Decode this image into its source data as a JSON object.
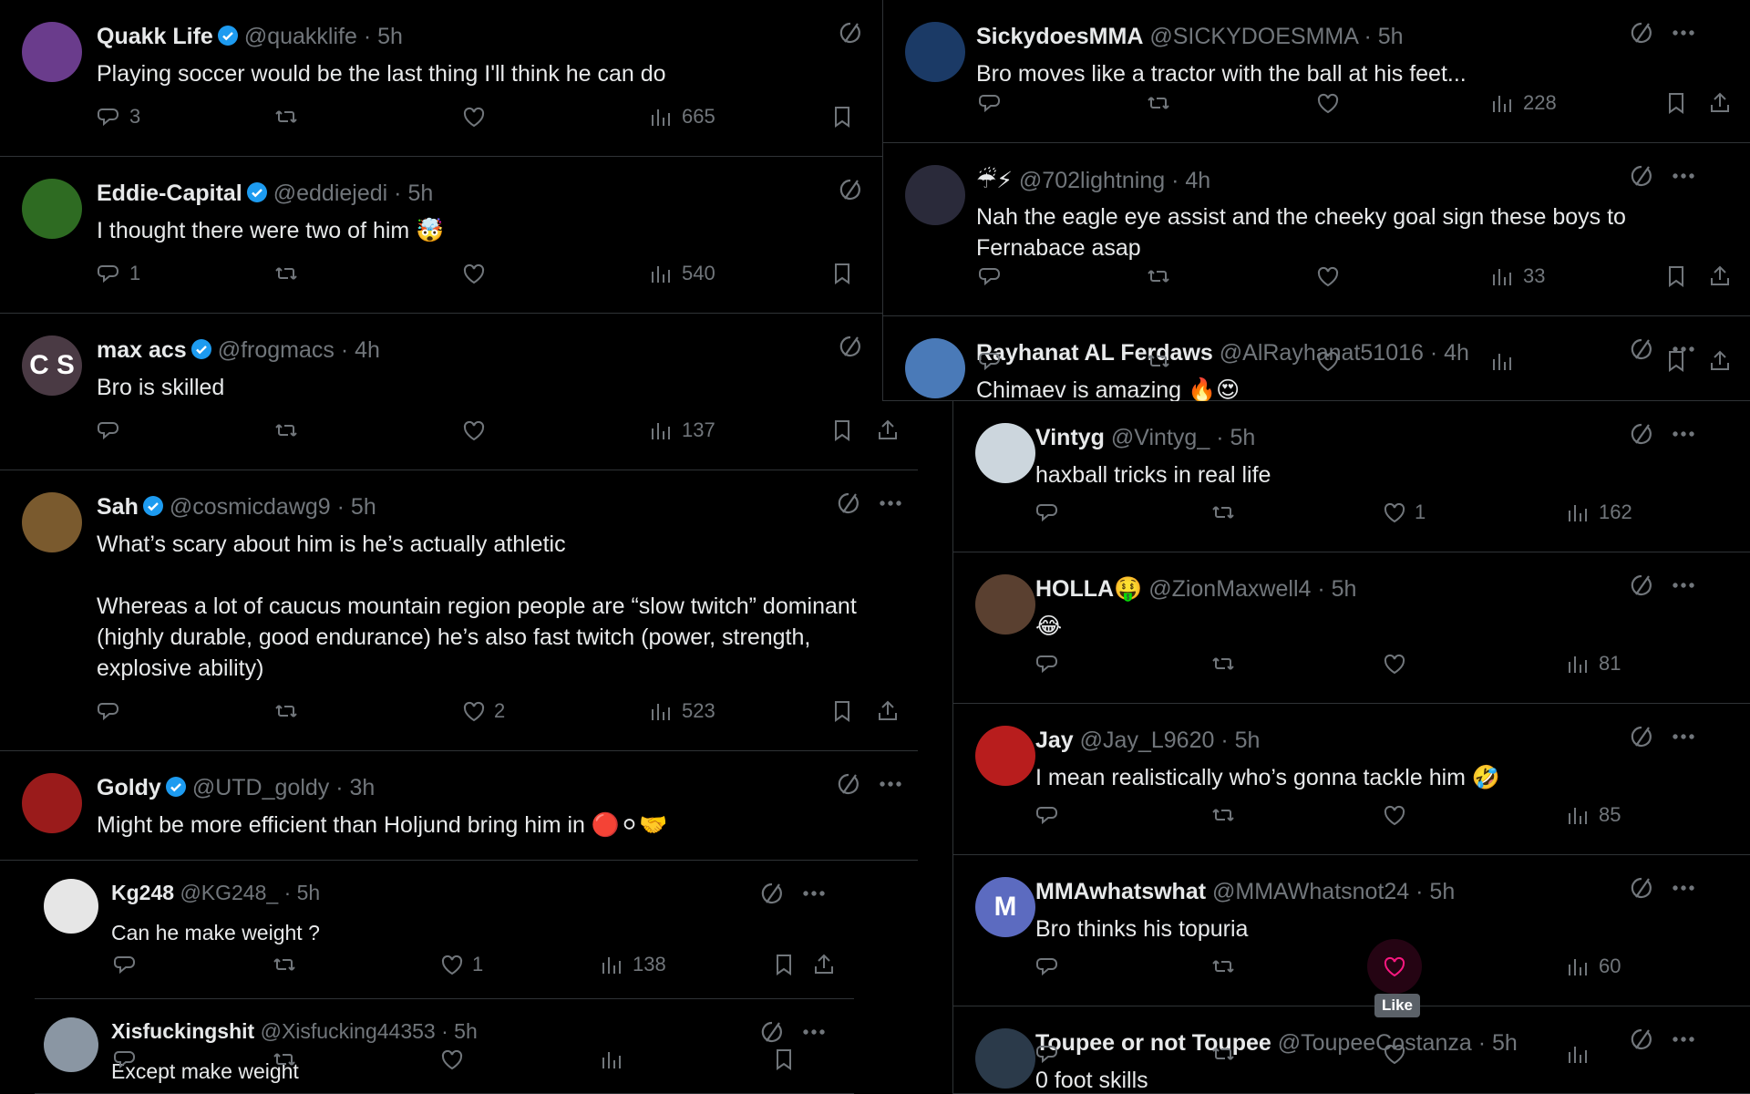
{
  "colors": {
    "background": "#000000",
    "text": "#e7e9ea",
    "muted": "#71767b",
    "verified": "#1d9bf0",
    "like_pink": "#f91880",
    "divider": "#2f3336"
  },
  "left_column": [
    {
      "name": "Quakk Life",
      "verified": true,
      "handle": "@quakklife",
      "time": "· 5h",
      "text": "Playing soccer would be the last thing I'll think he can do",
      "replies": "3",
      "retweets": "",
      "likes": "",
      "views": "665",
      "avatar_color": "#6a3c8c",
      "more_menu": false,
      "share": false
    },
    {
      "name": "Eddie-Capital",
      "verified": true,
      "handle": "@eddiejedi",
      "time": "· 5h",
      "text": "I thought there were two of him 🤯",
      "replies": "1",
      "retweets": "",
      "likes": "",
      "views": "540",
      "avatar_color": "#2e6b22",
      "more_menu": false,
      "share": false
    },
    {
      "name": "max acs",
      "verified": true,
      "handle": "@frogmacs",
      "time": "· 4h",
      "text": "Bro is skilled",
      "replies": "",
      "retweets": "",
      "likes": "",
      "views": "137",
      "avatar_color": "#4a3a44",
      "avatar_text": "C S",
      "more_menu": false,
      "share": true
    },
    {
      "name": "Sah",
      "verified": true,
      "handle": "@cosmicdawg9",
      "time": "· 5h",
      "text": "What’s scary about him is he’s actually athletic\n\nWhereas a lot of caucus mountain region people are “slow twitch” dominant (highly durable, good endurance) he’s also fast twitch (power, strength, explosive ability)",
      "replies": "",
      "retweets": "",
      "likes": "2",
      "views": "523",
      "avatar_color": "#7a5a2e",
      "more_menu": true,
      "share": true
    },
    {
      "name": "Goldy",
      "verified": true,
      "handle": "@UTD_goldy",
      "time": "· 3h",
      "text": "Might be more efficient than Holjund bring him in 🔴⚪🤝",
      "replies": "",
      "retweets": "",
      "likes": "",
      "views": "",
      "avatar_color": "#9a1b1b",
      "more_menu": true,
      "share": false
    },
    {
      "name": "Kg248",
      "verified": false,
      "handle": "@KG248_",
      "time": "· 5h",
      "text": "Can he make weight ?",
      "replies": "",
      "retweets": "",
      "likes": "1",
      "views": "138",
      "avatar_color": "#e6e6e6",
      "more_menu": true,
      "share": true,
      "reply": true
    },
    {
      "name": "Xisfuckingshit",
      "verified": false,
      "handle": "@Xisfucking44353",
      "time": "· 5h",
      "text": "Except make weight",
      "replies": "",
      "retweets": "",
      "likes": "",
      "views": "",
      "avatar_color": "#8a96a3",
      "more_menu": true,
      "share": false,
      "reply": true
    }
  ],
  "right_top_column": [
    {
      "name": "SickydoesMMA",
      "verified": false,
      "handle": "@SICKYDOESMMA",
      "time": "· 5h",
      "text": "Bro moves like a tractor with the ball at his feet...",
      "replies": "",
      "retweets": "",
      "likes": "",
      "views": "228",
      "avatar_color": "#1b3a66"
    },
    {
      "name": "☔⚡",
      "verified": false,
      "handle": "@702lightning",
      "time": "· 4h",
      "text": "Nah the eagle eye assist and the cheeky goal sign these boys to Fernabace asap",
      "replies": "",
      "retweets": "",
      "likes": "",
      "views": "33",
      "avatar_color": "#2a2a3a"
    },
    {
      "name": "Rayhanat AL Ferdaws",
      "verified": false,
      "handle": "@AlRayhanat51016",
      "time": "· 4h",
      "text": "Chimaev is amazing 🔥😍",
      "replies": "",
      "retweets": "",
      "likes": "",
      "views": "",
      "avatar_color": "#4a7ab8"
    }
  ],
  "right_bottom_column": [
    {
      "name": "Vintyg",
      "verified": false,
      "handle": "@Vintyg_",
      "time": "· 5h",
      "text": "haxball tricks in real life",
      "replies": "",
      "retweets": "",
      "likes": "1",
      "views": "162",
      "avatar_color": "#ccd6dd"
    },
    {
      "name": "HOLLA🤑",
      "verified": false,
      "handle": "@ZionMaxwell4",
      "time": "· 5h",
      "text": "😂",
      "replies": "",
      "retweets": "",
      "likes": "",
      "views": "81",
      "avatar_color": "#5a4030"
    },
    {
      "name": "Jay",
      "verified": false,
      "handle": "@Jay_L9620",
      "time": "· 5h",
      "text": "I mean realistically who’s gonna tackle him 🤣",
      "replies": "",
      "retweets": "",
      "likes": "",
      "views": "85",
      "avatar_color": "#b81d1d"
    },
    {
      "name": "MMAwhatswhat",
      "verified": false,
      "handle": "@MMAWhatsnot24",
      "time": "· 5h",
      "text": "Bro thinks his topuria",
      "replies": "",
      "retweets": "",
      "likes": "",
      "views": "60",
      "avatar_color": "#5c6bc0",
      "avatar_text": "M",
      "hover_like": true,
      "tooltip": "Like"
    },
    {
      "name": "Toupee or not Toupee",
      "verified": false,
      "handle": "@ToupeeCostanza",
      "time": "· 5h",
      "text": "0 foot skills",
      "replies": "",
      "retweets": "",
      "likes": "",
      "views": "",
      "avatar_color": "#2b3a4a"
    }
  ]
}
